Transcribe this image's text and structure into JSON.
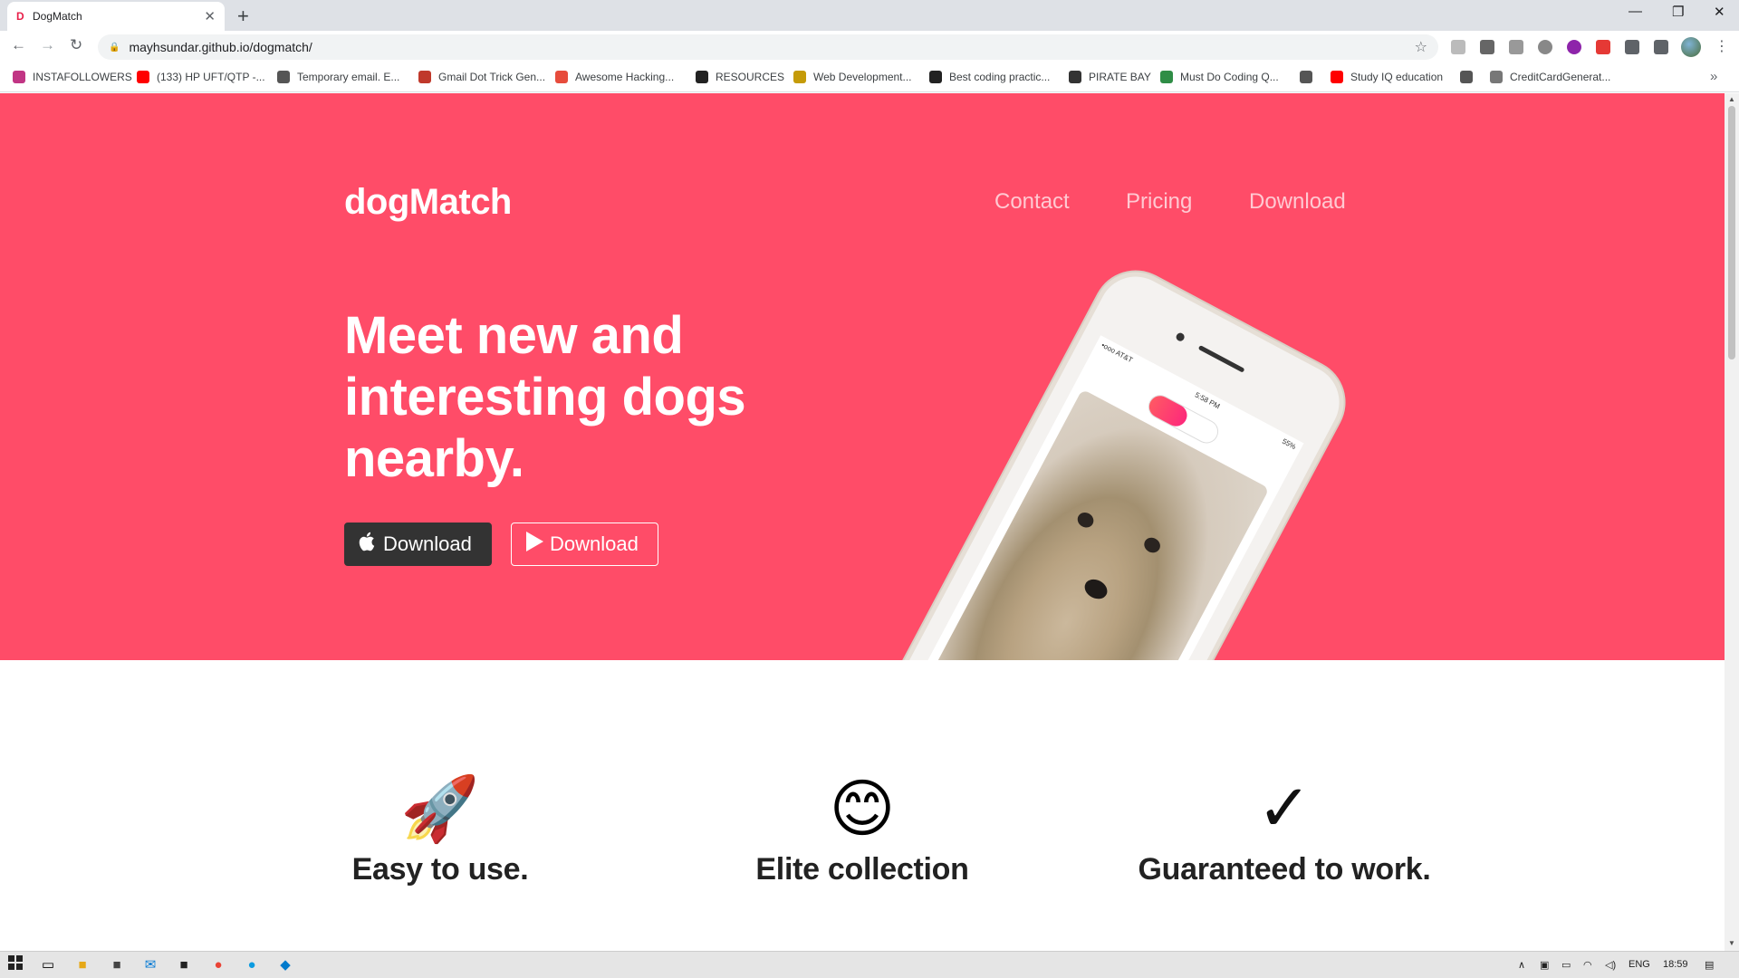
{
  "browser": {
    "tab_title": "DogMatch",
    "tab_favicon": "D",
    "url": "mayhsundar.github.io/dogmatch/",
    "bookmarks": [
      {
        "label": "INSTAFOLLOWERS",
        "icon": "instagram-icon",
        "color": "#c13584"
      },
      {
        "label": "(133) HP UFT/QTP -...",
        "icon": "youtube-icon",
        "color": "#ff0000"
      },
      {
        "label": "Temporary email. E...",
        "icon": "globe-icon",
        "color": "#555555"
      },
      {
        "label": "Gmail Dot Trick Gen...",
        "icon": "gmail-icon",
        "color": "#c0392b"
      },
      {
        "label": "Awesome Hacking...",
        "icon": "1h-icon",
        "color": "#e74c3c"
      },
      {
        "label": "RESOURCES",
        "icon": "github-icon",
        "color": "#222222"
      },
      {
        "label": "Web Development...",
        "icon": "bookmark-icon",
        "color": "#c59b08"
      },
      {
        "label": "Best coding practic...",
        "icon": "github-icon",
        "color": "#222222"
      },
      {
        "label": "PIRATE BAY",
        "icon": "ship-icon",
        "color": "#333333"
      },
      {
        "label": "Must Do Coding Q...",
        "icon": "gfg-icon",
        "color": "#2f8d46"
      },
      {
        "label": "",
        "icon": "globe-icon",
        "color": "#555555"
      },
      {
        "label": "Study IQ education",
        "icon": "youtube-icon",
        "color": "#ff0000"
      },
      {
        "label": "",
        "icon": "globe-icon",
        "color": "#555555"
      },
      {
        "label": "CreditCardGenerat...",
        "icon": "gear-icon",
        "color": "#777777"
      }
    ]
  },
  "site": {
    "brand": "dogMatch",
    "nav": [
      "Contact",
      "Pricing",
      "Download"
    ],
    "headline": "Meet new and interesting dogs nearby.",
    "buttons": [
      {
        "label": "Download",
        "icon": "apple-icon",
        "style": "dark"
      },
      {
        "label": "Download",
        "icon": "play-icon",
        "style": "outline"
      }
    ],
    "phone": {
      "carrier": "•ooo AT&T",
      "time": "5:58 PM",
      "battery": "55%"
    },
    "features": [
      {
        "icon": "🚀",
        "icon_name": "rocket-icon",
        "title": "Easy to use."
      },
      {
        "icon": "😊",
        "icon_name": "smiley-icon",
        "title": "Elite collection"
      },
      {
        "icon": "✓",
        "icon_name": "checkmark-icon",
        "title": "Guaranteed to work."
      }
    ],
    "colors": {
      "hero_bg": "#ff4c68",
      "dark_button": "#333333"
    }
  },
  "taskbar": {
    "language": "ENG",
    "time": "18:59"
  }
}
